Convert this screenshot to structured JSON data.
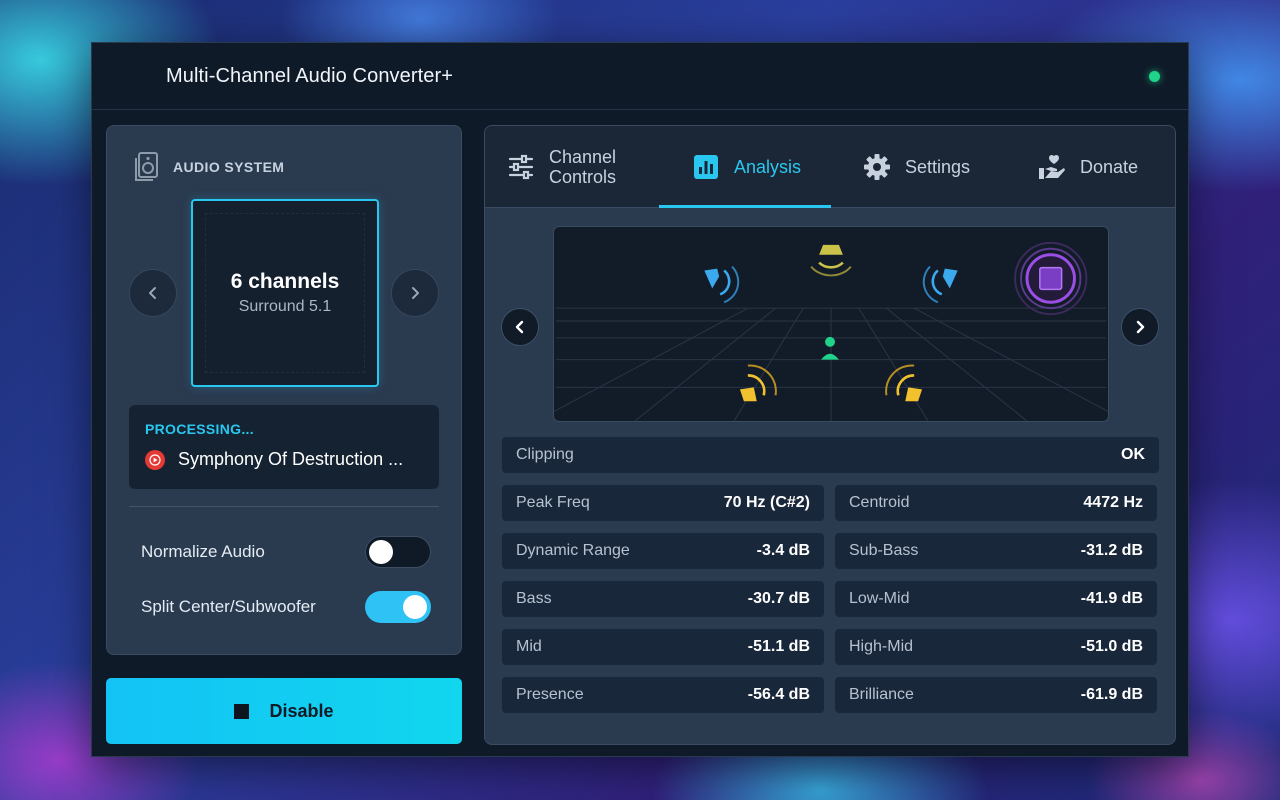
{
  "app": {
    "title": "Multi-Channel Audio Converter+"
  },
  "audio_system": {
    "label": "AUDIO SYSTEM",
    "channels": "6 channels",
    "mode": "Surround 5.1"
  },
  "processing": {
    "label": "PROCESSING...",
    "track": "Symphony Of Destruction ..."
  },
  "toggles": [
    {
      "label": "Normalize Audio",
      "on": false
    },
    {
      "label": "Split Center/Subwoofer",
      "on": true
    }
  ],
  "disable_button": {
    "label": "Disable"
  },
  "tabs": [
    {
      "label": "Channel Controls",
      "icon": "sliders-icon"
    },
    {
      "label": "Analysis",
      "icon": "chart-icon",
      "active": true
    },
    {
      "label": "Settings",
      "icon": "gear-icon"
    },
    {
      "label": "Donate",
      "icon": "donate-hand-icon"
    }
  ],
  "analysis": {
    "clipping": {
      "label": "Clipping",
      "value": "OK"
    },
    "stats": [
      {
        "label": "Peak Freq",
        "value": "70 Hz (C#2)"
      },
      {
        "label": "Centroid",
        "value": "4472 Hz"
      },
      {
        "label": "Dynamic Range",
        "value": "-3.4 dB"
      },
      {
        "label": "Sub-Bass",
        "value": "-31.2 dB"
      },
      {
        "label": "Bass",
        "value": "-30.7 dB"
      },
      {
        "label": "Low-Mid",
        "value": "-41.9 dB"
      },
      {
        "label": "Mid",
        "value": "-51.1 dB"
      },
      {
        "label": "High-Mid",
        "value": "-51.0 dB"
      },
      {
        "label": "Presence",
        "value": "-56.4 dB"
      },
      {
        "label": "Brilliance",
        "value": "-61.9 dB"
      }
    ]
  },
  "colors": {
    "accent": "#29c7f0",
    "status": "#1fd48a",
    "front_speakers": "#3aa9ee",
    "center_speaker": "#c9c34a",
    "rear_speakers": "#f2c12e",
    "subwoofer": "#9a4ee6",
    "listener": "#1fd48a"
  }
}
